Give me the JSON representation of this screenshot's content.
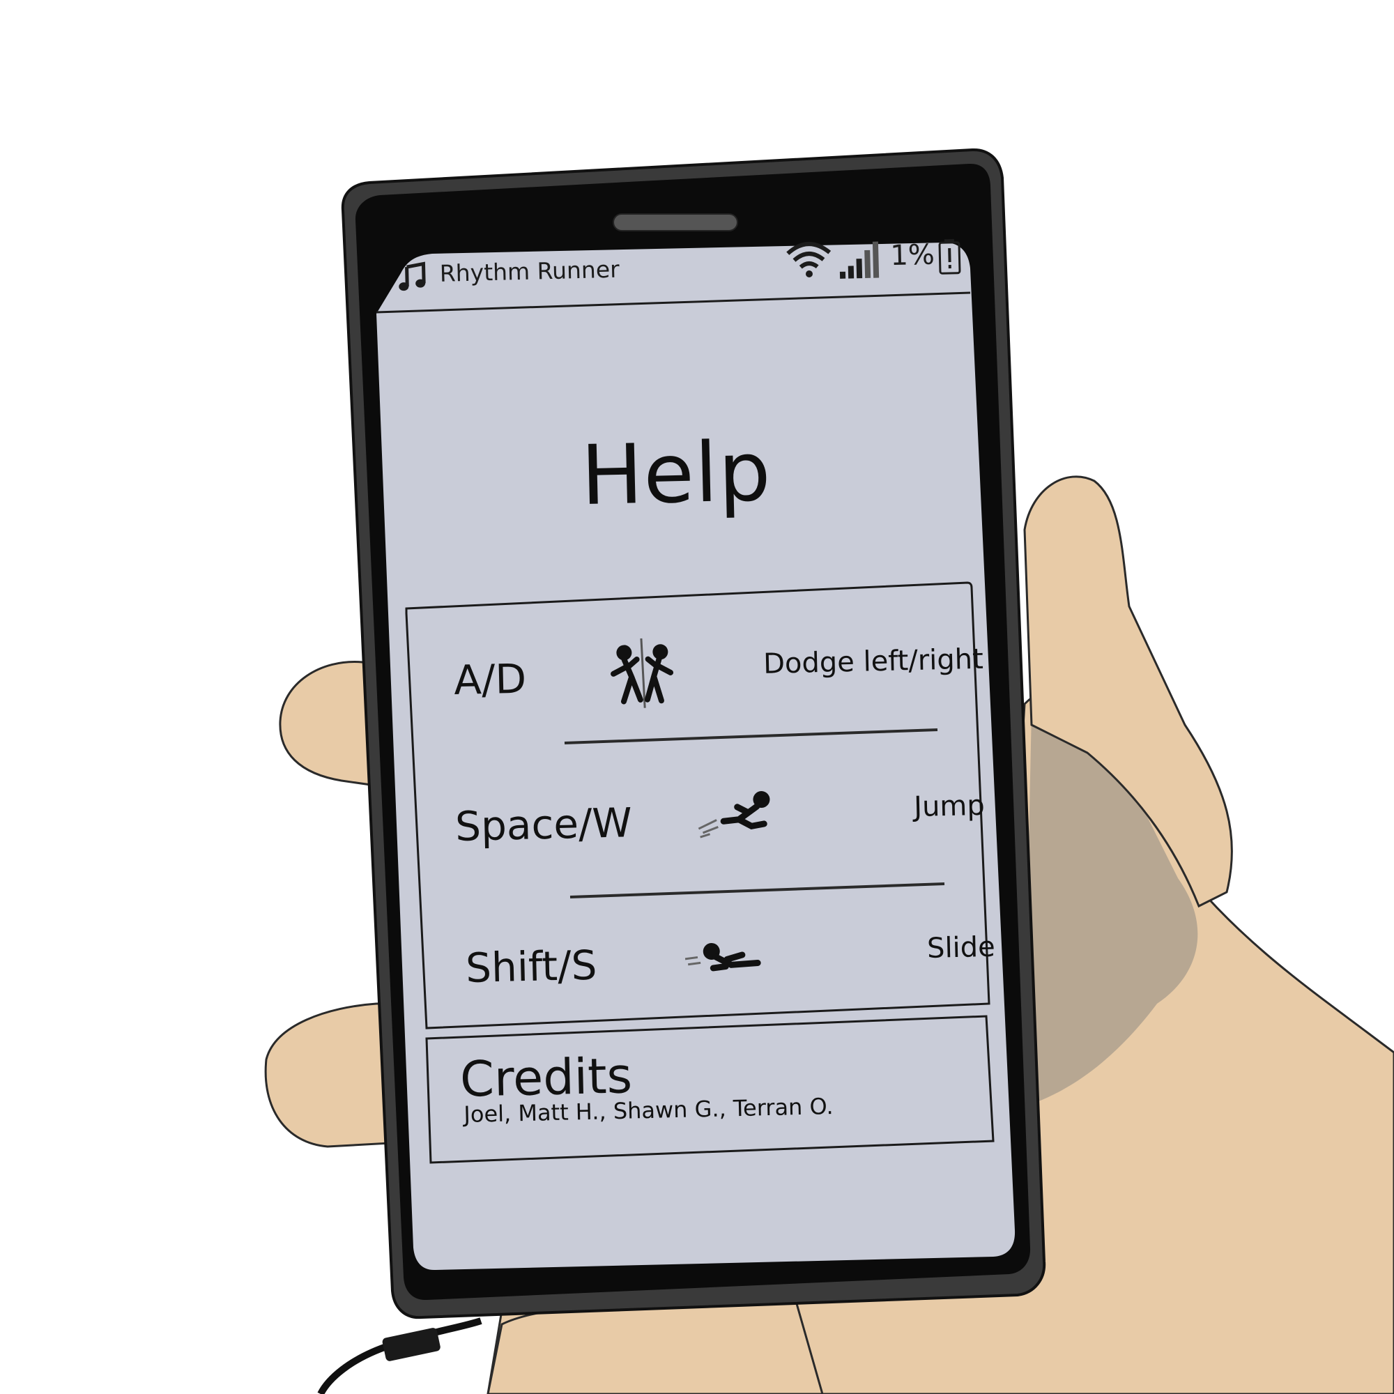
{
  "status_bar": {
    "app_title": "Rhythm Runner",
    "battery_percent": "1%",
    "icons": [
      "music-note-icon",
      "wifi-icon",
      "signal-bars-icon",
      "battery-low-icon"
    ]
  },
  "help": {
    "title": "Help",
    "controls": [
      {
        "key": "A/D",
        "action": "Dodge left/right",
        "icon": "dodge-figures-icon"
      },
      {
        "key": "Space/W",
        "action": "Jump",
        "icon": "jump-figure-icon"
      },
      {
        "key": "Shift/S",
        "action": "Slide",
        "icon": "slide-figure-icon"
      }
    ]
  },
  "credits": {
    "title": "Credits",
    "names": "Joel, Matt H., Shawn G., Terran O."
  },
  "colors": {
    "screen": "#c9ccd8",
    "phone_body": "#3a3a3a",
    "bezel": "#0b0b0b",
    "skin": "#e8cba7",
    "skin_shadow": "#b7a792",
    "ink": "#111111"
  }
}
